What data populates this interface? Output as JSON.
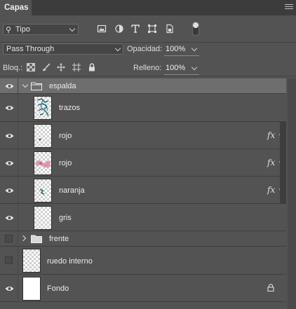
{
  "panel": {
    "tab_label": "Capas"
  },
  "filter": {
    "kind_label": "Tipo"
  },
  "blend": {
    "mode": "Pass Through",
    "opacity_label": "Opacidad:",
    "opacity_value": "100%",
    "lock_label": "Bloq.:",
    "fill_label": "Relleno:",
    "fill_value": "100%"
  },
  "layers": [
    {
      "name": "espalda",
      "type": "group",
      "expanded": true,
      "visible": true,
      "selected": true
    },
    {
      "name": "trazos",
      "type": "layer",
      "visible": true,
      "fx": false,
      "thumb": "strokes"
    },
    {
      "name": "rojo",
      "type": "layer",
      "visible": true,
      "fx": true,
      "thumb": "dot"
    },
    {
      "name": "rojo",
      "type": "layer",
      "visible": true,
      "fx": true,
      "thumb": "pink"
    },
    {
      "name": "naranja",
      "type": "layer",
      "visible": true,
      "fx": true,
      "thumb": "teal"
    },
    {
      "name": "gris",
      "type": "layer",
      "visible": true,
      "fx": false,
      "thumb": "empty"
    },
    {
      "name": "frente",
      "type": "group",
      "expanded": false,
      "visible": false
    },
    {
      "name": "ruedo interno",
      "type": "layer",
      "visible": false,
      "fx": false,
      "thumb": "empty"
    },
    {
      "name": "Fondo",
      "type": "background",
      "visible": true,
      "locked": true,
      "thumb": "white"
    }
  ],
  "fx_label": "fx",
  "colors": {
    "panel": "#535353",
    "selected_row": "#6e6e6e",
    "titlebar": "#3c3c3c",
    "text": "#e6e6e6"
  }
}
